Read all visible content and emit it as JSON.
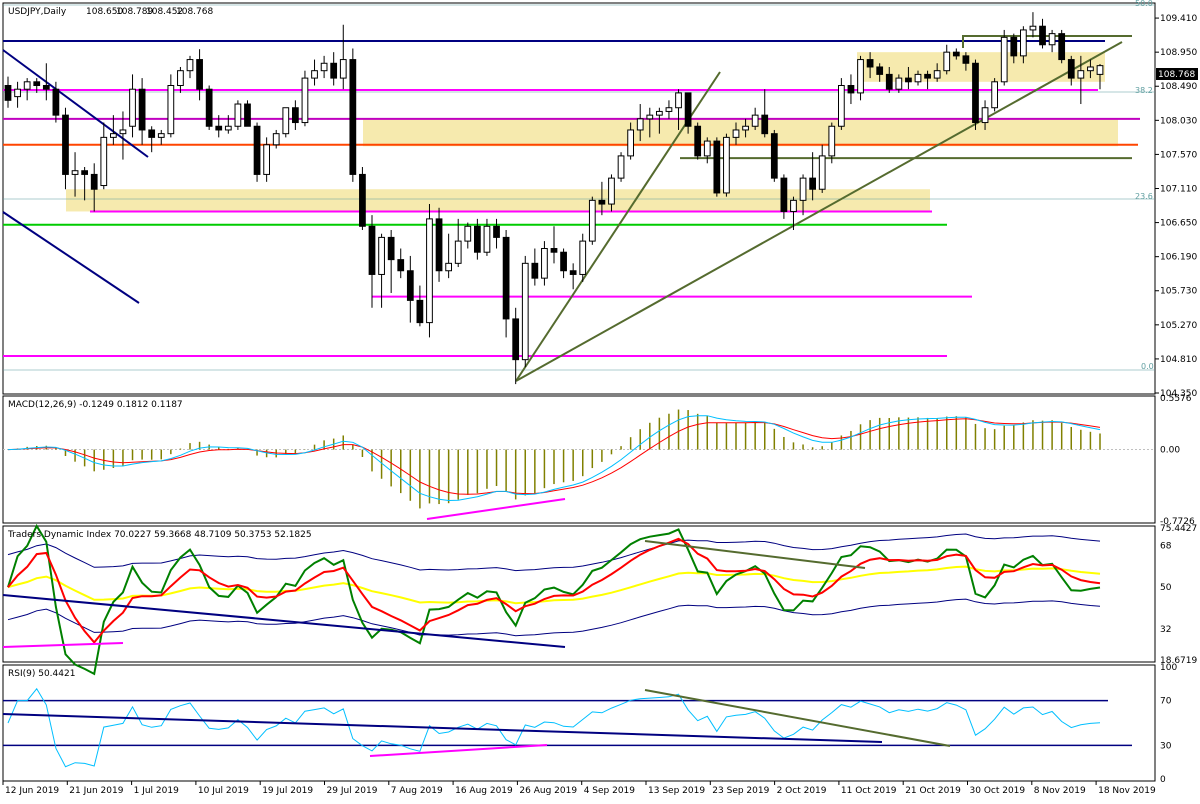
{
  "chart_data": [
    {
      "type": "candlestick",
      "symbol": "USDJPY",
      "timeframe": "Daily",
      "title": "USDJPY,Daily",
      "ohlc_header": [
        "108.650",
        "108.789",
        "108.452",
        "108.768"
      ],
      "current_price": "108.768",
      "y_ticks": [
        "109.410",
        "108.950",
        "108.490",
        "108.030",
        "107.570",
        "107.110",
        "106.650",
        "106.190",
        "105.730",
        "105.270",
        "104.810",
        "104.350"
      ],
      "ylim": [
        104.35,
        109.6
      ],
      "x_ticks": [
        "12 Jun 2019",
        "21 Jun 2019",
        "1 Jul 2019",
        "10 Jul 2019",
        "19 Jul 2019",
        "29 Jul 2019",
        "7 Aug 2019",
        "16 Aug 2019",
        "26 Aug 2019",
        "4 Sep 2019",
        "13 Sep 2019",
        "23 Sep 2019",
        "2 Oct 2019",
        "11 Oct 2019",
        "21 Oct 2019",
        "30 Oct 2019",
        "8 Nov 2019",
        "18 Nov 2019"
      ],
      "fib_labels": {
        "top": "50.0",
        "mid": "38.2",
        "low": "23.6",
        "bottom": "0.0"
      },
      "candles": [
        {
          "date": "12 Jun",
          "o": 108.5,
          "h": 108.62,
          "l": 108.2,
          "c": 108.3
        },
        {
          "date": "13 Jun",
          "o": 108.35,
          "h": 108.55,
          "l": 108.2,
          "c": 108.45
        },
        {
          "date": "14 Jun",
          "o": 108.45,
          "h": 108.6,
          "l": 108.3,
          "c": 108.55
        },
        {
          "date": "17 Jun",
          "o": 108.55,
          "h": 108.6,
          "l": 108.4,
          "c": 108.5
        },
        {
          "date": "18 Jun",
          "o": 108.5,
          "h": 108.8,
          "l": 108.3,
          "c": 108.45
        },
        {
          "date": "19 Jun",
          "o": 108.45,
          "h": 108.55,
          "l": 108.0,
          "c": 108.1
        },
        {
          "date": "20 Jun",
          "o": 108.1,
          "h": 108.2,
          "l": 107.1,
          "c": 107.3
        },
        {
          "date": "21 Jun",
          "o": 107.3,
          "h": 107.6,
          "l": 107.0,
          "c": 107.35
        },
        {
          "date": "24 Jun",
          "o": 107.35,
          "h": 107.4,
          "l": 106.95,
          "c": 107.3
        },
        {
          "date": "25 Jun",
          "o": 107.3,
          "h": 107.45,
          "l": 106.8,
          "c": 107.1
        },
        {
          "date": "26 Jun",
          "o": 107.15,
          "h": 108.0,
          "l": 107.1,
          "c": 107.8
        },
        {
          "date": "27 Jun",
          "o": 107.8,
          "h": 108.1,
          "l": 107.7,
          "c": 107.85
        },
        {
          "date": "28 Jun",
          "o": 107.85,
          "h": 108.15,
          "l": 107.5,
          "c": 107.9
        },
        {
          "date": "1 Jul",
          "o": 107.95,
          "h": 108.65,
          "l": 107.8,
          "c": 108.45
        },
        {
          "date": "2 Jul",
          "o": 108.45,
          "h": 108.6,
          "l": 107.7,
          "c": 107.9
        },
        {
          "date": "3 Jul",
          "o": 107.9,
          "h": 107.95,
          "l": 107.6,
          "c": 107.8
        },
        {
          "date": "4 Jul",
          "o": 107.8,
          "h": 107.9,
          "l": 107.7,
          "c": 107.85
        },
        {
          "date": "5 Jul",
          "o": 107.85,
          "h": 108.65,
          "l": 107.8,
          "c": 108.5
        },
        {
          "date": "8 Jul",
          "o": 108.5,
          "h": 108.75,
          "l": 108.4,
          "c": 108.7
        },
        {
          "date": "9 Jul",
          "o": 108.7,
          "h": 108.9,
          "l": 108.6,
          "c": 108.85
        },
        {
          "date": "10 Jul",
          "o": 108.85,
          "h": 108.99,
          "l": 108.3,
          "c": 108.45
        },
        {
          "date": "11 Jul",
          "o": 108.45,
          "h": 108.5,
          "l": 107.9,
          "c": 107.95
        },
        {
          "date": "12 Jul",
          "o": 107.95,
          "h": 108.1,
          "l": 107.8,
          "c": 107.9
        },
        {
          "date": "15 Jul",
          "o": 107.9,
          "h": 108.1,
          "l": 107.85,
          "c": 107.95
        },
        {
          "date": "16 Jul",
          "o": 107.95,
          "h": 108.3,
          "l": 107.9,
          "c": 108.25
        },
        {
          "date": "17 Jul",
          "o": 108.25,
          "h": 108.3,
          "l": 107.95,
          "c": 107.95
        },
        {
          "date": "18 Jul",
          "o": 107.95,
          "h": 108.0,
          "l": 107.2,
          "c": 107.3
        },
        {
          "date": "19 Jul",
          "o": 107.3,
          "h": 107.8,
          "l": 107.2,
          "c": 107.7
        },
        {
          "date": "22 Jul",
          "o": 107.7,
          "h": 107.9,
          "l": 107.65,
          "c": 107.85
        },
        {
          "date": "23 Jul",
          "o": 107.85,
          "h": 108.2,
          "l": 107.8,
          "c": 108.2
        },
        {
          "date": "24 Jul",
          "o": 108.2,
          "h": 108.3,
          "l": 107.9,
          "c": 108.0
        },
        {
          "date": "25 Jul",
          "o": 108.0,
          "h": 108.7,
          "l": 107.95,
          "c": 108.6
        },
        {
          "date": "26 Jul",
          "o": 108.6,
          "h": 108.85,
          "l": 108.5,
          "c": 108.7
        },
        {
          "date": "29 Jul",
          "o": 108.7,
          "h": 108.9,
          "l": 108.6,
          "c": 108.8
        },
        {
          "date": "30 Jul",
          "o": 108.8,
          "h": 108.95,
          "l": 108.5,
          "c": 108.6
        },
        {
          "date": "31 Jul",
          "o": 108.6,
          "h": 109.32,
          "l": 108.45,
          "c": 108.85
        },
        {
          "date": "1 Aug",
          "o": 108.85,
          "h": 109.0,
          "l": 107.2,
          "c": 107.3
        },
        {
          "date": "2 Aug",
          "o": 107.3,
          "h": 107.4,
          "l": 106.55,
          "c": 106.6
        },
        {
          "date": "5 Aug",
          "o": 106.6,
          "h": 106.75,
          "l": 105.5,
          "c": 105.95
        },
        {
          "date": "6 Aug",
          "o": 105.95,
          "h": 106.5,
          "l": 105.5,
          "c": 106.45
        },
        {
          "date": "7 Aug",
          "o": 106.45,
          "h": 106.55,
          "l": 105.7,
          "c": 106.15
        },
        {
          "date": "8 Aug",
          "o": 106.15,
          "h": 106.3,
          "l": 105.9,
          "c": 106.0
        },
        {
          "date": "9 Aug",
          "o": 106.0,
          "h": 106.2,
          "l": 105.3,
          "c": 105.6
        },
        {
          "date": "12 Aug",
          "o": 105.6,
          "h": 105.8,
          "l": 105.25,
          "c": 105.3
        },
        {
          "date": "13 Aug",
          "o": 105.3,
          "h": 106.9,
          "l": 105.1,
          "c": 106.7
        },
        {
          "date": "14 Aug",
          "o": 106.7,
          "h": 106.85,
          "l": 105.85,
          "c": 106.0
        },
        {
          "date": "15 Aug",
          "o": 106.0,
          "h": 106.5,
          "l": 105.9,
          "c": 106.1
        },
        {
          "date": "16 Aug",
          "o": 106.1,
          "h": 106.7,
          "l": 106.05,
          "c": 106.4
        },
        {
          "date": "19 Aug",
          "o": 106.4,
          "h": 106.65,
          "l": 106.3,
          "c": 106.6
        },
        {
          "date": "20 Aug",
          "o": 106.6,
          "h": 106.7,
          "l": 106.15,
          "c": 106.25
        },
        {
          "date": "21 Aug",
          "o": 106.25,
          "h": 106.7,
          "l": 106.2,
          "c": 106.6
        },
        {
          "date": "22 Aug",
          "o": 106.6,
          "h": 106.7,
          "l": 106.3,
          "c": 106.45
        },
        {
          "date": "23 Aug",
          "o": 106.45,
          "h": 106.55,
          "l": 105.1,
          "c": 105.35
        },
        {
          "date": "26 Aug",
          "o": 105.35,
          "h": 105.5,
          "l": 104.47,
          "c": 104.8
        },
        {
          "date": "27 Aug",
          "o": 104.8,
          "h": 106.2,
          "l": 104.7,
          "c": 106.1
        },
        {
          "date": "28 Aug",
          "o": 106.1,
          "h": 106.3,
          "l": 105.8,
          "c": 105.9
        },
        {
          "date": "29 Aug",
          "o": 105.9,
          "h": 106.4,
          "l": 105.8,
          "c": 106.3
        },
        {
          "date": "30 Aug",
          "o": 106.3,
          "h": 106.6,
          "l": 106.1,
          "c": 106.25
        },
        {
          "date": "2 Sep",
          "o": 106.25,
          "h": 106.3,
          "l": 105.9,
          "c": 106.0
        },
        {
          "date": "3 Sep",
          "o": 106.0,
          "h": 106.1,
          "l": 105.75,
          "c": 105.95
        },
        {
          "date": "4 Sep",
          "o": 105.95,
          "h": 106.5,
          "l": 105.85,
          "c": 106.4
        },
        {
          "date": "5 Sep",
          "o": 106.4,
          "h": 107.0,
          "l": 106.35,
          "c": 106.95
        },
        {
          "date": "6 Sep",
          "o": 106.95,
          "h": 107.2,
          "l": 106.75,
          "c": 106.9
        },
        {
          "date": "9 Sep",
          "o": 106.9,
          "h": 107.3,
          "l": 106.8,
          "c": 107.25
        },
        {
          "date": "10 Sep",
          "o": 107.25,
          "h": 107.6,
          "l": 107.2,
          "c": 107.55
        },
        {
          "date": "11 Sep",
          "o": 107.55,
          "h": 108.0,
          "l": 107.5,
          "c": 107.9
        },
        {
          "date": "12 Sep",
          "o": 107.9,
          "h": 108.25,
          "l": 107.75,
          "c": 108.05
        },
        {
          "date": "13 Sep",
          "o": 108.05,
          "h": 108.2,
          "l": 107.8,
          "c": 108.1
        },
        {
          "date": "16 Sep",
          "o": 108.1,
          "h": 108.2,
          "l": 107.85,
          "c": 108.15
        },
        {
          "date": "17 Sep",
          "o": 108.15,
          "h": 108.3,
          "l": 108.05,
          "c": 108.2
        },
        {
          "date": "18 Sep",
          "o": 108.2,
          "h": 108.45,
          "l": 107.9,
          "c": 108.4
        },
        {
          "date": "19 Sep",
          "o": 108.4,
          "h": 108.4,
          "l": 107.85,
          "c": 107.95
        },
        {
          "date": "20 Sep",
          "o": 107.95,
          "h": 108.0,
          "l": 107.5,
          "c": 107.55
        },
        {
          "date": "23 Sep",
          "o": 107.55,
          "h": 107.8,
          "l": 107.45,
          "c": 107.75
        },
        {
          "date": "24 Sep",
          "o": 107.75,
          "h": 107.8,
          "l": 107.0,
          "c": 107.05
        },
        {
          "date": "25 Sep",
          "o": 107.05,
          "h": 107.85,
          "l": 107.0,
          "c": 107.8
        },
        {
          "date": "26 Sep",
          "o": 107.8,
          "h": 108.0,
          "l": 107.7,
          "c": 107.9
        },
        {
          "date": "27 Sep",
          "o": 107.9,
          "h": 108.05,
          "l": 107.8,
          "c": 107.95
        },
        {
          "date": "30 Sep",
          "o": 107.95,
          "h": 108.2,
          "l": 107.9,
          "c": 108.1
        },
        {
          "date": "1 Oct",
          "o": 108.1,
          "h": 108.45,
          "l": 107.8,
          "c": 107.85
        },
        {
          "date": "2 Oct",
          "o": 107.85,
          "h": 107.9,
          "l": 107.2,
          "c": 107.25
        },
        {
          "date": "3 Oct",
          "o": 107.25,
          "h": 107.3,
          "l": 106.7,
          "c": 106.8
        },
        {
          "date": "4 Oct",
          "o": 106.8,
          "h": 107.0,
          "l": 106.55,
          "c": 106.95
        },
        {
          "date": "7 Oct",
          "o": 106.95,
          "h": 107.3,
          "l": 106.75,
          "c": 107.25
        },
        {
          "date": "8 Oct",
          "o": 107.25,
          "h": 107.6,
          "l": 106.95,
          "c": 107.1
        },
        {
          "date": "9 Oct",
          "o": 107.1,
          "h": 107.7,
          "l": 107.05,
          "c": 107.55
        },
        {
          "date": "10 Oct",
          "o": 107.55,
          "h": 108.0,
          "l": 107.45,
          "c": 107.95
        },
        {
          "date": "11 Oct",
          "o": 107.95,
          "h": 108.6,
          "l": 107.9,
          "c": 108.5
        },
        {
          "date": "14 Oct",
          "o": 108.5,
          "h": 108.65,
          "l": 108.25,
          "c": 108.4
        },
        {
          "date": "15 Oct",
          "o": 108.4,
          "h": 108.9,
          "l": 108.3,
          "c": 108.85
        },
        {
          "date": "16 Oct",
          "o": 108.85,
          "h": 108.95,
          "l": 108.6,
          "c": 108.75
        },
        {
          "date": "17 Oct",
          "o": 108.75,
          "h": 108.8,
          "l": 108.55,
          "c": 108.65
        },
        {
          "date": "18 Oct",
          "o": 108.65,
          "h": 108.75,
          "l": 108.4,
          "c": 108.45
        },
        {
          "date": "21 Oct",
          "o": 108.45,
          "h": 108.65,
          "l": 108.4,
          "c": 108.6
        },
        {
          "date": "22 Oct",
          "o": 108.6,
          "h": 108.75,
          "l": 108.45,
          "c": 108.55
        },
        {
          "date": "23 Oct",
          "o": 108.55,
          "h": 108.7,
          "l": 108.5,
          "c": 108.65
        },
        {
          "date": "24 Oct",
          "o": 108.65,
          "h": 108.7,
          "l": 108.45,
          "c": 108.6
        },
        {
          "date": "25 Oct",
          "o": 108.6,
          "h": 108.8,
          "l": 108.55,
          "c": 108.7
        },
        {
          "date": "28 Oct",
          "o": 108.7,
          "h": 109.05,
          "l": 108.65,
          "c": 108.95
        },
        {
          "date": "29 Oct",
          "o": 108.95,
          "h": 109.0,
          "l": 108.85,
          "c": 108.9
        },
        {
          "date": "30 Oct",
          "o": 108.9,
          "h": 108.95,
          "l": 108.7,
          "c": 108.8
        },
        {
          "date": "31 Oct",
          "o": 108.8,
          "h": 108.85,
          "l": 107.9,
          "c": 108.0
        },
        {
          "date": "1 Nov",
          "o": 108.0,
          "h": 108.3,
          "l": 107.9,
          "c": 108.2
        },
        {
          "date": "4 Nov",
          "o": 108.2,
          "h": 108.6,
          "l": 108.15,
          "c": 108.55
        },
        {
          "date": "5 Nov",
          "o": 108.55,
          "h": 109.25,
          "l": 108.5,
          "c": 109.15
        },
        {
          "date": "6 Nov",
          "o": 109.15,
          "h": 109.2,
          "l": 108.8,
          "c": 108.9
        },
        {
          "date": "7 Nov",
          "o": 108.9,
          "h": 109.3,
          "l": 108.8,
          "c": 109.25
        },
        {
          "date": "8 Nov",
          "o": 109.25,
          "h": 109.49,
          "l": 109.15,
          "c": 109.3
        },
        {
          "date": "11 Nov",
          "o": 109.3,
          "h": 109.4,
          "l": 109.0,
          "c": 109.05
        },
        {
          "date": "12 Nov",
          "o": 109.05,
          "h": 109.25,
          "l": 108.95,
          "c": 109.2
        },
        {
          "date": "13 Nov",
          "o": 109.2,
          "h": 109.25,
          "l": 108.8,
          "c": 108.85
        },
        {
          "date": "14 Nov",
          "o": 108.85,
          "h": 108.9,
          "l": 108.5,
          "c": 108.6
        },
        {
          "date": "15 Nov",
          "o": 108.6,
          "h": 108.9,
          "l": 108.25,
          "c": 108.7
        },
        {
          "date": "18 Nov",
          "o": 108.7,
          "h": 108.85,
          "l": 108.6,
          "c": 108.75
        },
        {
          "date": "19 Nov",
          "o": 108.65,
          "h": 108.79,
          "l": 108.45,
          "c": 108.768
        }
      ],
      "horizontal_levels": [
        {
          "name": "navy-upper-level",
          "price": 109.1,
          "color": "#000080"
        },
        {
          "name": "magenta-level-1",
          "price": 108.44,
          "color": "#ff00ff"
        },
        {
          "name": "magenta-level-2",
          "price": 108.05,
          "color": "#c000c0"
        },
        {
          "name": "orange-level",
          "price": 107.7,
          "color": "#ff4500"
        },
        {
          "name": "olive-level",
          "price": 107.52,
          "color": "#556b2f"
        },
        {
          "name": "magenta-level-3",
          "price": 106.8,
          "color": "#ff00ff"
        },
        {
          "name": "green-level",
          "price": 106.62,
          "color": "#00cc00"
        },
        {
          "name": "magenta-level-4",
          "price": 105.65,
          "color": "#ff00ff"
        },
        {
          "name": "magenta-level-5",
          "price": 104.85,
          "color": "#ff00ff"
        }
      ],
      "zones": [
        {
          "name": "zone-upper",
          "p1": 108.95,
          "p2": 108.55,
          "color": "#f5e6a0"
        },
        {
          "name": "zone-middle",
          "p1": 108.05,
          "p2": 107.68,
          "color": "#f5e6a0"
        },
        {
          "name": "zone-lower",
          "p1": 107.1,
          "p2": 106.8,
          "color": "#f5e6a0"
        }
      ]
    },
    {
      "type": "bar-line",
      "title": "MACD(12,26,9) -0.1249 0.1812 0.1187",
      "y_ticks": [
        "0.5576",
        "0.00",
        "-0.7726"
      ],
      "ylim": [
        -0.7726,
        0.5576
      ],
      "colors": {
        "histogram": "#808000",
        "signal": "#ff0000",
        "main": "#00bfff"
      }
    },
    {
      "type": "line",
      "title": "Traders Dynamic Index 70.0227 59.3668 48.7109 50.3753 52.1825",
      "y_ticks": [
        "75.4427",
        "68",
        "50",
        "32",
        "18.6719"
      ],
      "ylim": [
        18.6719,
        75.4427
      ],
      "colors": {
        "bands": "#000080",
        "fast": "#008000",
        "slow": "#ff0000",
        "middle": "#ffff00"
      }
    },
    {
      "type": "line",
      "title": "RSI(9) 50.4421",
      "y_ticks": [
        "100",
        "70",
        "30",
        "0"
      ],
      "ylim": [
        0,
        100
      ],
      "colors": {
        "line": "#00bfff",
        "levels": "#000080"
      }
    }
  ]
}
